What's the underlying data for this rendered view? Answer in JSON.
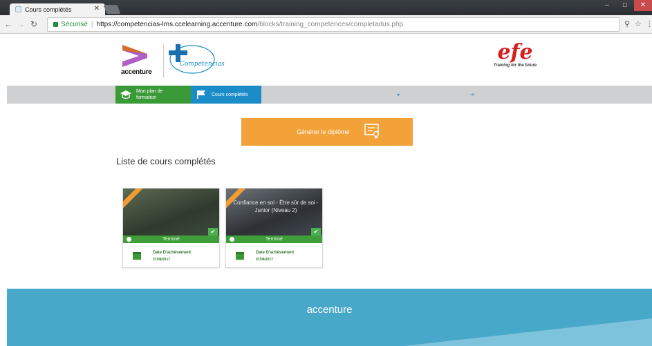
{
  "browser": {
    "tab_title": "Cours complétés",
    "secure_label": "Sécurisé",
    "url_host": "https://competencias-lms.ccelearning.accenture.com",
    "url_path": "/blocks/training_competences/completadus.php"
  },
  "header": {
    "accenture_wordmark": "accenture",
    "competencias_label": "Competencias",
    "efe_logo": "efe",
    "efe_tagline": "Training for the future"
  },
  "nav": {
    "plan_label": "Mon plan de formation",
    "completed_label": "Cours complétés",
    "link_1": "",
    "link_2": ""
  },
  "main": {
    "generate_button": "Générer le diplôme",
    "page_title": "Liste de cours complétés",
    "cards": [
      {
        "title": "",
        "status": "Terminé",
        "date_label": "Date D'achèvement",
        "date_value": "27/08/2017"
      },
      {
        "title": "Confiance en soi - Être sûr de soi - Junior (Niveau 2)",
        "status": "Terminé",
        "date_label": "Date D'achèvement",
        "date_value": "07/08/2017"
      }
    ]
  },
  "footer": {
    "logo": "accenture",
    "subtitle": "",
    "copyright": ""
  },
  "colors": {
    "green": "#3a9a37",
    "blue": "#1b8cc8",
    "orange": "#f3a239",
    "footer": "#47a8c9"
  }
}
